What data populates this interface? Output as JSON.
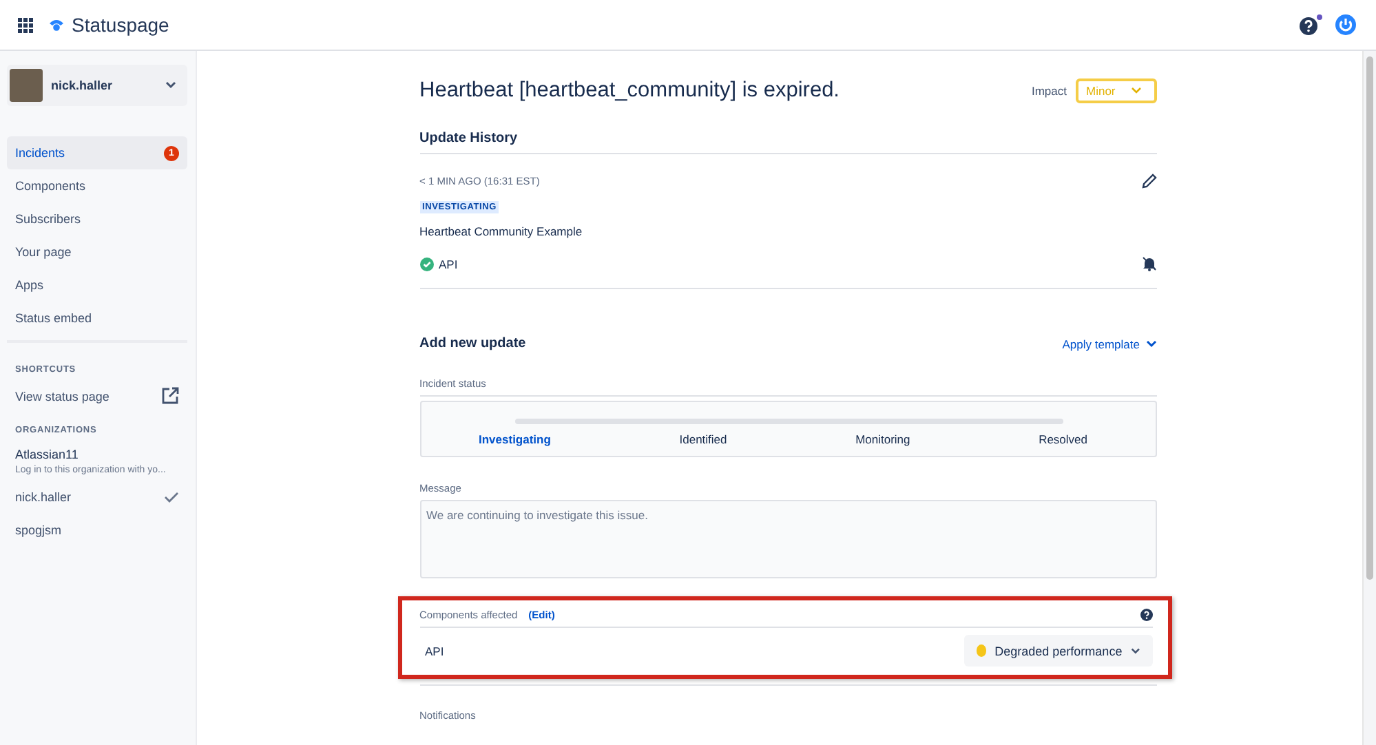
{
  "app": {
    "name": "Statuspage"
  },
  "sidebar": {
    "user": "nick.haller",
    "items": [
      {
        "label": "Incidents",
        "selected": true,
        "badge": "1"
      },
      {
        "label": "Components",
        "selected": false
      },
      {
        "label": "Subscribers",
        "selected": false
      },
      {
        "label": "Your page",
        "selected": false
      },
      {
        "label": "Apps",
        "selected": false
      },
      {
        "label": "Status embed",
        "selected": false
      }
    ],
    "shortcuts_heading": "SHORTCUTS",
    "shortcut": "View status page",
    "organizations_heading": "ORGANIZATIONS",
    "organizations": [
      {
        "name": "Atlassian11",
        "note": "Log in to this organization with yo...",
        "checked": false
      },
      {
        "name": "nick.haller",
        "checked": true
      },
      {
        "name": "spogjsm",
        "checked": false
      }
    ]
  },
  "incident": {
    "title": "Heartbeat [heartbeat_community] is expired.",
    "impact_label": "Impact",
    "impact": "Minor"
  },
  "history": {
    "heading": "Update History",
    "time": "< 1 MIN AGO (16:31 EST)",
    "status": "INVESTIGATING",
    "message": "Heartbeat Community Example",
    "component": "API"
  },
  "new_update": {
    "heading": "Add new update",
    "template": "Apply template",
    "status_label": "Incident status",
    "steps": [
      {
        "label": "Investigating",
        "selected": true
      },
      {
        "label": "Identified",
        "selected": false
      },
      {
        "label": "Monitoring",
        "selected": false
      },
      {
        "label": "Resolved",
        "selected": false
      }
    ],
    "message_label": "Message",
    "message_placeholder": "We are continuing to investigate this issue.",
    "components_label": "Components affected",
    "edit": "(Edit)",
    "components": [
      {
        "name": "API",
        "status": "Degraded performance",
        "color": "#f5c518"
      }
    ],
    "notifications_label": "Notifications"
  }
}
